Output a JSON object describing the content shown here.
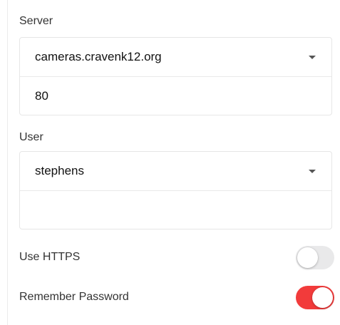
{
  "server": {
    "label": "Server",
    "host": "cameras.cravenk12.org",
    "port": "80"
  },
  "user": {
    "label": "User",
    "username": "stephens",
    "password": ""
  },
  "settings": {
    "use_https": {
      "label": "Use HTTPS",
      "enabled": false
    },
    "remember_password": {
      "label": "Remember Password",
      "enabled": true
    }
  },
  "colors": {
    "toggle_on": "#f23b3b",
    "toggle_off": "#e9e9ea"
  },
  "icons": {
    "dropdown": "caret-down-icon"
  }
}
